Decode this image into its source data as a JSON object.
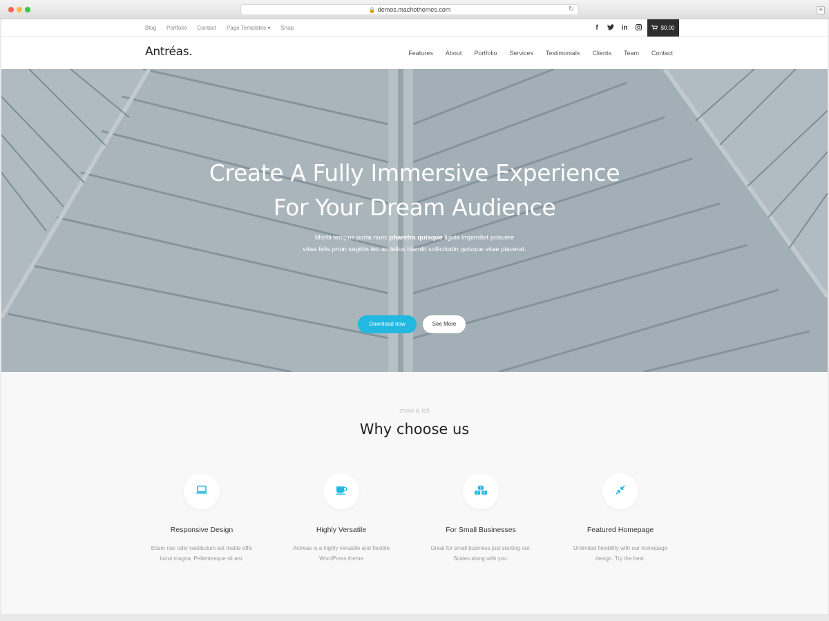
{
  "browser": {
    "url": "demos.machothemes.com"
  },
  "topbar": {
    "links": [
      "Blog",
      "Portfolio",
      "Contact",
      "Page Templates ▾",
      "Shop"
    ],
    "social_icons": [
      "facebook-icon",
      "twitter-icon",
      "linkedin-icon",
      "instagram-icon"
    ],
    "cart_total": "$0.00"
  },
  "header": {
    "logo": "Antréas.",
    "menu": [
      "Features",
      "About",
      "Portfolio",
      "Services",
      "Testimonials",
      "Clients",
      "Team",
      "Contact"
    ]
  },
  "hero": {
    "title_line1": "Create A Fully Immersive Experience",
    "title_line2": "For Your Dream Audience",
    "sub_line1_a": "Morbi tempus porta nunc ",
    "sub_line1_b": "pharetra quisque",
    "sub_line1_c": " ligula imperdiet posuere",
    "sub_line2_a": "vitae felis proin sagittis leo ac tellus blandit sollicitudin ",
    "sub_line2_b": "quisque",
    "sub_line2_c": " vitae placerat.",
    "primary_button": "Download now",
    "secondary_button": "See More"
  },
  "why": {
    "eyebrow": "show & tell",
    "title": "Why choose us",
    "features": [
      {
        "icon": "laptop-icon",
        "title": "Responsive Design",
        "desc_line1": "Etiam nec odio vestibulum est mattis effic",
        "desc_line2": "iturut magna. Pellentesque sit am."
      },
      {
        "icon": "coffee-cup-icon",
        "title": "Highly Versatile",
        "desc_line1": "Antreas is a highly versatile and flexible",
        "desc_line2": "WordPress theme"
      },
      {
        "icon": "cubes-icon",
        "title": "For Small Businesses",
        "desc_line1": "Great for small business just starting out.",
        "desc_line2": "Scales along with you."
      },
      {
        "icon": "compress-icon",
        "title": "Featured Homepage",
        "desc_line1": "Unlimited flexibility with our homepage",
        "desc_line2": "design. Try the best."
      }
    ]
  },
  "colors": {
    "accent": "#22b8e0",
    "dark": "#2e2e2e"
  }
}
